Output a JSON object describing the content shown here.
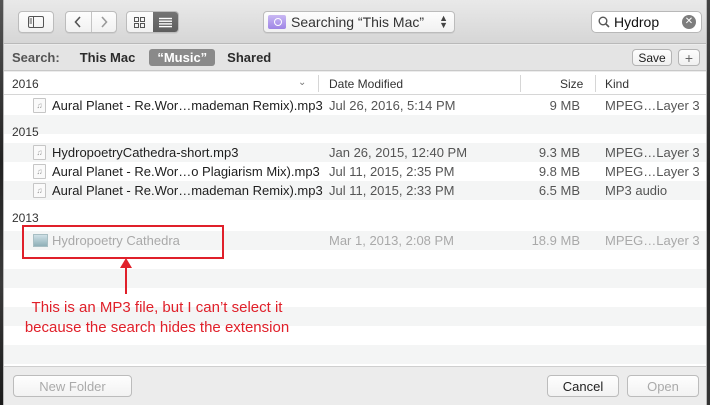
{
  "toolbar": {
    "location": "Searching “This Mac”",
    "search_value": "Hydrop"
  },
  "scope": {
    "label": "Search:",
    "options": [
      "This Mac",
      "“Music”",
      "Shared"
    ],
    "save_label": "Save",
    "add_label": "+"
  },
  "columns": {
    "name": "2016",
    "date": "Date Modified",
    "size": "Size",
    "kind": "Kind"
  },
  "groups": [
    {
      "label": "2016",
      "files": [
        {
          "name": "Aural Planet - Re.Wor…mademan Remix).mp3",
          "date": "Jul 26, 2016, 5:14 PM",
          "size": "9 MB",
          "kind": "MPEG…Layer 3"
        }
      ]
    },
    {
      "label": "2015",
      "files": [
        {
          "name": "HydropoetryCathedra-short.mp3",
          "date": "Jan 26, 2015, 12:40 PM",
          "size": "9.3 MB",
          "kind": "MPEG…Layer 3"
        },
        {
          "name": "Aural Planet - Re.Wor…o Plagiarism Mix).mp3",
          "date": "Jul 11, 2015, 2:35 PM",
          "size": "9.8 MB",
          "kind": "MPEG…Layer 3"
        },
        {
          "name": "Aural Planet - Re.Wor…mademan Remix).mp3",
          "date": "Jul 11, 2015, 2:33 PM",
          "size": "6.5 MB",
          "kind": "MP3 audio"
        }
      ]
    },
    {
      "label": "2013",
      "files": [
        {
          "name": "Hydropoetry Cathedra",
          "date": "Mar 1, 2013, 2:08 PM",
          "size": "18.9 MB",
          "kind": "MPEG…Layer 3"
        }
      ]
    }
  ],
  "annotation": {
    "line1": "This is an MP3 file, but I can’t select it",
    "line2": "because the search hides the extension"
  },
  "bottom": {
    "new_folder": "New Folder",
    "cancel": "Cancel",
    "open": "Open"
  },
  "colors": {
    "annotation": "#e0202a",
    "scope_active": "#8a8a8a"
  }
}
